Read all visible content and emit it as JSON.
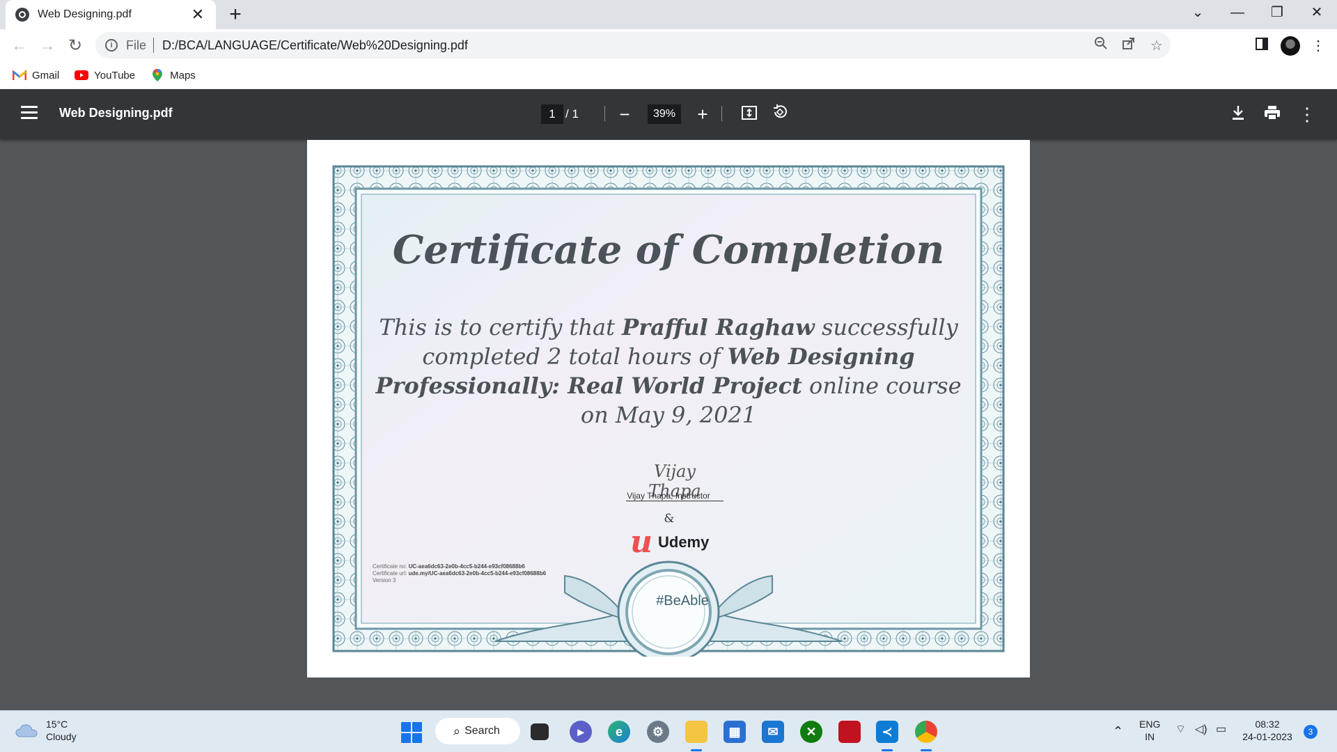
{
  "tab": {
    "title": "Web Designing.pdf",
    "close": "✕",
    "new_tab": "+"
  },
  "window": {
    "tabsearch": "⌄",
    "minimize": "—",
    "restore": "❐",
    "close": "✕"
  },
  "address": {
    "scheme": "File",
    "url": "D:/BCA/LANGUAGE/Certificate/Web%20Designing.pdf"
  },
  "bookmarks": [
    {
      "label": "Gmail"
    },
    {
      "label": "YouTube"
    },
    {
      "label": "Maps"
    }
  ],
  "pdf": {
    "title": "Web Designing.pdf",
    "page_current": "1",
    "page_total": "/  1",
    "zoom": "39%"
  },
  "certificate": {
    "title": "Certificate of Completion",
    "body_intro": "This is to certify that ",
    "name": "Prafful Raghaw",
    "body_mid": " successfully completed 2 total hours of ",
    "course": "Web Designing Professionally: Real World Project",
    "body_end": " online course on May 9, 2021",
    "signature": "Vijay Thapa",
    "instructor": "Vijay Thapa, Instructor",
    "ampersand": "&",
    "udemy_mark": "u",
    "udemy_name": "Udemy",
    "cert_no_label": "Certificate no: ",
    "cert_no": "UC-aea6dc63-2e0b-4cc5-b244-e93cf08688b6",
    "cert_url_label": "Certificate url: ",
    "cert_url": "ude.my/UC-aea6dc63-2e0b-4cc5-b244-e93cf08688b6",
    "version": "Version 3",
    "hashtag": "#BeAble"
  },
  "taskbar": {
    "temperature": "15°C",
    "condition": "Cloudy",
    "search_label": "Search",
    "language_top": "ENG",
    "language_bottom": "IN",
    "time": "08:32",
    "date": "24-01-2023",
    "notifications": "3"
  },
  "colors": {
    "pdf_background": "#525659",
    "pdf_toolbar": "#323639",
    "udemy_red": "#ec5252",
    "taskbar": "#dfe9f2",
    "accent": "#1a73e8"
  }
}
